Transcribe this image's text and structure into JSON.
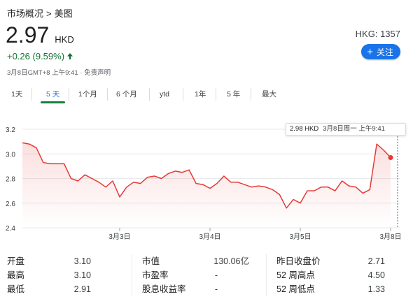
{
  "breadcrumb": {
    "parent": "市场概况",
    "separator": ">",
    "current": "美图"
  },
  "quote": {
    "price": "2.97",
    "currency": "HKD",
    "ticker": "HKG: 1357",
    "change": "+0.26 (9.59%)",
    "meta": "3月8日GMT+8 上午9:41 · 免责声明",
    "follow_label": "关注"
  },
  "tabs": [
    {
      "label": "1天"
    },
    {
      "label": "5 天"
    },
    {
      "label": "1个月"
    },
    {
      "label": "6 个月"
    },
    {
      "label": "ytd"
    },
    {
      "label": "1年"
    },
    {
      "label": "5 年"
    },
    {
      "label": "最大"
    }
  ],
  "active_tab": 1,
  "tooltip": {
    "price": "2.98 HKD",
    "time": "3月8日周一 上午9:41"
  },
  "colors": {
    "line": "#e53935",
    "up": "#137333",
    "accent": "#1a73e8",
    "tab_underline": "#188038"
  },
  "chart_data": {
    "type": "area",
    "title": "",
    "xlabel": "",
    "ylabel": "",
    "ylim": [
      2.4,
      3.2
    ],
    "y_ticks": [
      "3.2",
      "3.0",
      "2.8",
      "2.6",
      "2.4"
    ],
    "x_ticks": [
      "3月3日",
      "3月4日",
      "3月5日",
      "3月8日"
    ],
    "x_tick_positions": [
      14,
      27,
      40,
      53
    ],
    "grid": true,
    "highlight_index": 54,
    "series": [
      {
        "values": [
          3.09,
          3.08,
          3.05,
          2.93,
          2.92,
          2.92,
          2.92,
          2.8,
          2.78,
          2.83,
          2.8,
          2.77,
          2.73,
          2.78,
          2.65,
          2.73,
          2.77,
          2.76,
          2.81,
          2.82,
          2.8,
          2.84,
          2.86,
          2.85,
          2.87,
          2.76,
          2.75,
          2.72,
          2.76,
          2.82,
          2.77,
          2.77,
          2.75,
          2.73,
          2.74,
          2.73,
          2.71,
          2.67,
          2.56,
          2.63,
          2.6,
          2.7,
          2.7,
          2.73,
          2.73,
          2.7,
          2.78,
          2.74,
          2.73,
          2.68,
          2.71,
          3.08,
          3.03,
          2.97
        ]
      }
    ]
  },
  "stats": [
    [
      {
        "key": "开盘",
        "value": "3.10"
      },
      {
        "key": "最高",
        "value": "3.10"
      },
      {
        "key": "最低",
        "value": "2.91"
      }
    ],
    [
      {
        "key": "市值",
        "value": "130.06亿"
      },
      {
        "key": "市盈率",
        "value": "-"
      },
      {
        "key": "股息收益率",
        "value": "-"
      }
    ],
    [
      {
        "key": "昨日收盘价",
        "value": "2.71"
      },
      {
        "key": "52 周高点",
        "value": "4.50"
      },
      {
        "key": "52 周低点",
        "value": "1.33"
      }
    ]
  ]
}
